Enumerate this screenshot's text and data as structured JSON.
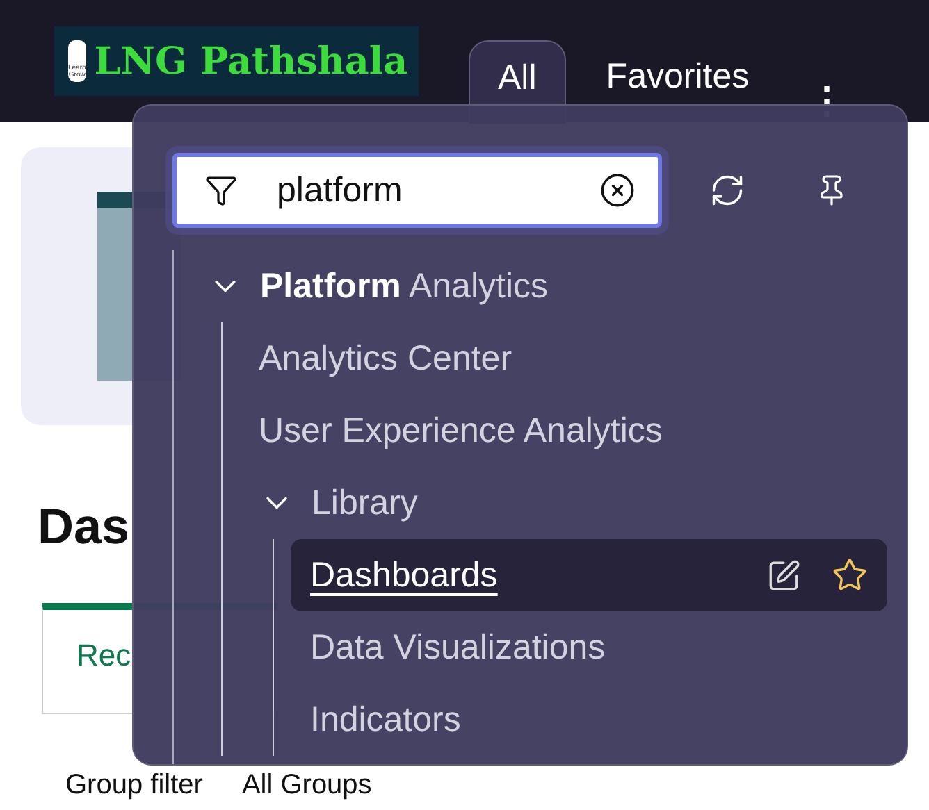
{
  "logo": {
    "name": "LNG Pathshala",
    "badge": [
      "Learn",
      "Grow"
    ]
  },
  "nav_tabs": [
    {
      "label": "All",
      "selected": true
    },
    {
      "label": "Favorites",
      "selected": false
    }
  ],
  "menu_icon": "⋮",
  "page": {
    "heading": "Das",
    "tab": "Rec",
    "filter_label": "Group filter",
    "filter_value": "All Groups"
  },
  "popup": {
    "search": {
      "value": "platform"
    },
    "tree": [
      {
        "label": "**Platform** Analytics",
        "expanded": true,
        "children": [
          {
            "label": "Analytics Center",
            "selected": false
          },
          {
            "label": "User Experience Analytics",
            "selected": false
          },
          {
            "label": "Library",
            "expanded": true,
            "children": [
              {
                "label": "Dashboards",
                "selected": true
              },
              {
                "label": "Data Visualizations",
                "selected": false
              },
              {
                "label": "Indicators",
                "selected": false
              }
            ]
          }
        ]
      }
    ]
  }
}
